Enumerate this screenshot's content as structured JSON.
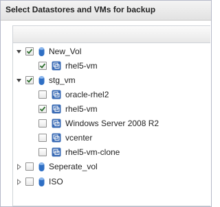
{
  "window": {
    "title": "Select Datastores and VMs for backup"
  },
  "tree": {
    "new_vol": {
      "label": "New_Vol",
      "checked": true,
      "expanded": true
    },
    "new_vol_rhel5": {
      "label": "rhel5-vm",
      "checked": true
    },
    "stg_vm": {
      "label": "stg_vm",
      "checked": true,
      "expanded": true
    },
    "oracle": {
      "label": "oracle-rhel2",
      "checked": false
    },
    "stg_rhel5": {
      "label": "rhel5-vm",
      "checked": true
    },
    "windows": {
      "label": "Windows Server 2008 R2",
      "checked": false
    },
    "vcenter": {
      "label": "vcenter",
      "checked": false
    },
    "clone": {
      "label": "rhel5-vm-clone",
      "checked": false
    },
    "seperate_vol": {
      "label": "Seperate_vol",
      "checked": false,
      "expanded": false
    },
    "iso": {
      "label": "ISO",
      "checked": false,
      "expanded": false
    }
  },
  "icons": {
    "datastore": "datastore-icon",
    "vm": "vm-icon",
    "expanded": "triangle-down-icon",
    "collapsed": "triangle-right-icon",
    "check": "checkmark-icon"
  },
  "colors": {
    "datastore_blue": "#2f6fc4",
    "vm_blue": "#3a6bb5",
    "check_green": "#2f6f2f"
  }
}
